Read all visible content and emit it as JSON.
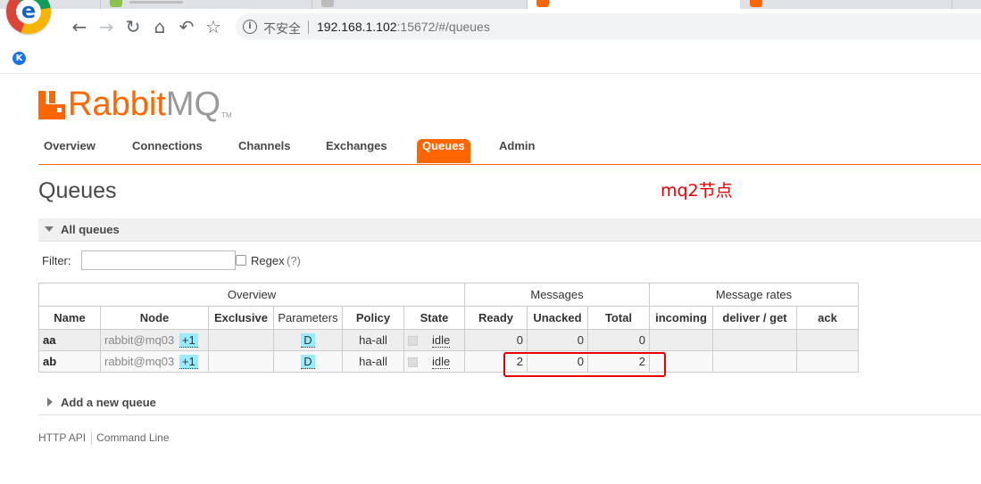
{
  "browser": {
    "address_security": "不安全",
    "url_host": "192.168.1.102",
    "url_rest": ":15672/#/queues",
    "bookmark_icon_letter": "K",
    "chrome_logo_letter": "e"
  },
  "logo": {
    "rabbit": "Rabbit",
    "mq": "MQ",
    "tm": "TM"
  },
  "nav": {
    "tabs": [
      "Overview",
      "Connections",
      "Channels",
      "Exchanges",
      "Queues",
      "Admin"
    ],
    "selected": "Queues"
  },
  "page_title": "Queues",
  "annotation": "mq2节点",
  "all_queues": {
    "label": "All queues"
  },
  "filter": {
    "label": "Filter:",
    "value": "",
    "regex_label": "Regex",
    "help": "(?)"
  },
  "table": {
    "groups": [
      "Overview",
      "Messages",
      "Message rates"
    ],
    "columns": [
      "Name",
      "Node",
      "Exclusive",
      "Parameters",
      "Policy",
      "State",
      "Ready",
      "Unacked",
      "Total",
      "incoming",
      "deliver / get",
      "ack"
    ],
    "rows": [
      {
        "name": "aa",
        "node": "rabbit@mq03",
        "node_plus": "+1",
        "exclusive": "",
        "parameters": "D",
        "policy": "ha-all",
        "state": "idle",
        "ready": "0",
        "unacked": "0",
        "total": "0",
        "incoming": "",
        "deliver_get": "",
        "ack": ""
      },
      {
        "name": "ab",
        "node": "rabbit@mq03",
        "node_plus": "+1",
        "exclusive": "",
        "parameters": "D",
        "policy": "ha-all",
        "state": "idle",
        "ready": "2",
        "unacked": "0",
        "total": "2",
        "incoming": "",
        "deliver_get": "",
        "ack": ""
      }
    ]
  },
  "add_queue": {
    "label": "Add a new queue"
  },
  "footer": {
    "links": [
      "HTTP API",
      "Command Line"
    ]
  },
  "colors": {
    "accent": "#ff6600",
    "annotation": "#e60000",
    "policy_highlight": "#99ebff"
  }
}
